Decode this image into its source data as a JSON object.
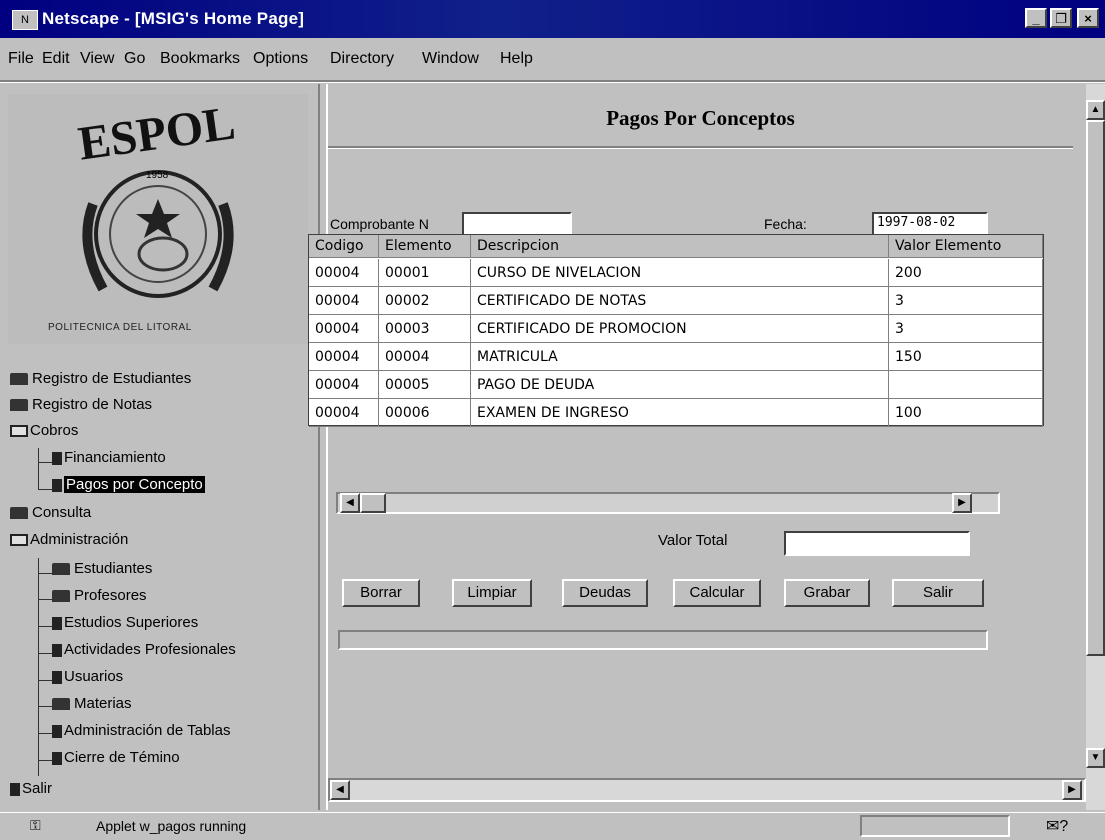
{
  "window": {
    "title": "Netscape - [MSIG's Home Page]",
    "app_icon": "netscape-icon",
    "controls": [
      "_",
      "🗗",
      "×"
    ]
  },
  "menu": [
    "File",
    "Edit",
    "View",
    "Go",
    "Bookmarks",
    "Options",
    "Directory",
    "Window",
    "Help"
  ],
  "menu_underline": [
    "F",
    "E",
    "V",
    "G",
    "B",
    "O",
    "D",
    "W",
    "H"
  ],
  "logo": {
    "text": "ESPOL",
    "year": "1958",
    "sub": "POLITECNICA DEL LITORAL"
  },
  "nav_tree": [
    {
      "label": "Registro de Estudiantes",
      "icon": "folder-icon",
      "level": 0
    },
    {
      "label": "Registro de Notas",
      "icon": "folder-icon",
      "level": 0
    },
    {
      "label": "Cobros",
      "icon": "folder-open-icon",
      "level": 0
    },
    {
      "label": "Financiamiento",
      "icon": "document-icon",
      "level": 1
    },
    {
      "label": "Pagos por Concepto",
      "icon": "document-icon",
      "level": 1,
      "selected": true
    },
    {
      "label": "Consulta",
      "icon": "folder-icon",
      "level": 0
    },
    {
      "label": "Administración",
      "icon": "folder-open-icon",
      "level": 0
    },
    {
      "label": "Estudiantes",
      "icon": "folder-icon",
      "level": 1
    },
    {
      "label": "Profesores",
      "icon": "folder-icon",
      "level": 1
    },
    {
      "label": "Estudios Superiores",
      "icon": "document-icon",
      "level": 1
    },
    {
      "label": "Actividades Profesionales",
      "icon": "document-icon",
      "level": 1
    },
    {
      "label": "Usuarios",
      "icon": "document-icon",
      "level": 1
    },
    {
      "label": "Materias",
      "icon": "folder-icon",
      "level": 1
    },
    {
      "label": "Administración de Tablas",
      "icon": "document-icon",
      "level": 1
    },
    {
      "label": "Cierre de Témino",
      "icon": "document-icon",
      "level": 1
    },
    {
      "label": "Salir",
      "icon": "document-icon",
      "level": 0
    }
  ],
  "form": {
    "title": "Pagos Por Conceptos",
    "comprobante_label": "Comprobante N",
    "comprobante_value": "",
    "fecha_label": "Fecha:",
    "fecha_value": "1997-08-02",
    "valor_total_label": "Valor Total",
    "valor_total_value": "",
    "buttons": [
      "Borrar",
      "Limpiar",
      "Deudas",
      "Calcular",
      "Grabar",
      "Salir"
    ]
  },
  "table": {
    "headers": [
      "Codigo",
      "Elemento",
      "Descripcion",
      "Valor Elemento"
    ],
    "rows": [
      [
        "00004",
        "00001",
        "CURSO DE NIVELACION",
        "200"
      ],
      [
        "00004",
        "00002",
        "CERTIFICADO DE NOTAS",
        "3"
      ],
      [
        "00004",
        "00003",
        "CERTIFICADO DE PROMOCION",
        "3"
      ],
      [
        "00004",
        "00004",
        "MATRICULA",
        "150"
      ],
      [
        "00004",
        "00005",
        "PAGO DE DEUDA",
        ""
      ],
      [
        "00004",
        "00006",
        "EXAMEN DE INGRESO",
        "100"
      ]
    ]
  },
  "status": {
    "text": "Applet w_pagos running"
  }
}
